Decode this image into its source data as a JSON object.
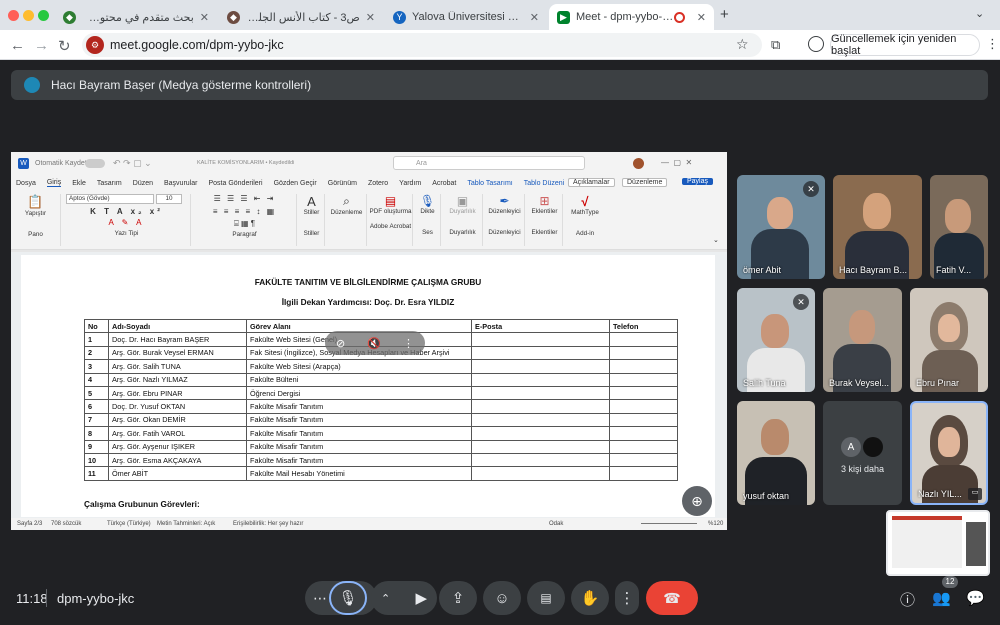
{
  "browser": {
    "tabs": [
      {
        "label": "بحث متقدم في محتوى المكتبة الش",
        "active": false
      },
      {
        "label": "ص3 - كتاب الأنس الجليل بتاريخ ال",
        "active": false
      },
      {
        "label": "Yalova Üniversitesi Uzaktan E",
        "active": false
      },
      {
        "label": "Meet - dpm-yybo-jkc",
        "active": true
      }
    ],
    "new_tab": "+",
    "url": "meet.google.com/dpm-yybo-jkc",
    "update_button": "Güncellemek için yeniden başlat",
    "menu": "⋮"
  },
  "meet": {
    "presenter_banner": "Hacı Bayram Başer (Medya gösterme kontrolleri)",
    "time": "11:18",
    "meeting_code": "dpm-yybo-jkc",
    "participant_count": "12",
    "participants": [
      {
        "name": "ömer Abit",
        "muted": true
      },
      {
        "name": "Hacı Bayram B...",
        "muted": false
      },
      {
        "name": "Fatih V...",
        "muted": false
      },
      {
        "name": "Salih Tuna",
        "muted": true
      },
      {
        "name": "Burak Veysel...",
        "muted": false
      },
      {
        "name": "Ebru Pınar",
        "muted": false
      },
      {
        "name": "yusuf oktan",
        "muted": false
      },
      {
        "name": "3 kişi daha",
        "avatar_letter": "A"
      },
      {
        "name": "Nazlı YIL...",
        "muted": false
      }
    ]
  },
  "word": {
    "autosave": "Otomatik Kaydet",
    "doc_title": "KALİTE KOMİSYONLARIM • Kaydedildi",
    "search": "Ara",
    "menu": [
      "Dosya",
      "Giriş",
      "Ekle",
      "Tasarım",
      "Düzen",
      "Başvurular",
      "Posta Gönderileri",
      "Gözden Geçir",
      "Görünüm",
      "Zotero",
      "Yardım",
      "Acrobat",
      "Tablo Tasarımı",
      "Tablo Düzeni"
    ],
    "comments_btn": "Açıklamalar",
    "editing_btn": "Düzenleme",
    "share_btn": "Paylaş",
    "font": "Aptos (Gövde)",
    "font_size": "10",
    "groups": [
      "Pano",
      "Yazı Tipi",
      "Paragraf",
      "Stiller",
      "Adobe Acrobat",
      "Ses",
      "Duyarlılık",
      "Düzenleyici",
      "Eklentiler",
      "Add-in"
    ],
    "ribbon_btns": [
      "Yapıştır",
      "Stiller",
      "Düzenleme",
      "PDF oluşturma",
      "Dikte",
      "Duyarlılık",
      "Düzenleyici",
      "Eklentiler",
      "MathType"
    ],
    "heading": "FAKÜLTE TANITIM VE BİLGİLENDİRME ÇALIŞMA GRUBU",
    "subheading": "İlgili Dekan Yardımcısı: Doç. Dr. Esra YILDIZ",
    "table_headers": [
      "No",
      "Adı-Soyadı",
      "Görev Alanı",
      "E-Posta",
      "Telefon"
    ],
    "rows": [
      [
        "1",
        "Doç. Dr. Hacı Bayram BAŞER",
        "Fakülte Web Sitesi (Genel)"
      ],
      [
        "2",
        "Arş. Gör. Burak Veysel ERMAN",
        "Fak Sitesi (İngilizce), Sosyal Medya Hesapları ve Haber Arşivi"
      ],
      [
        "3",
        "Arş. Gör. Salih TUNA",
        "Fakülte Web Sitesi (Arapça)"
      ],
      [
        "4",
        "Arş. Gör. Nazlı YILMAZ",
        "Fakülte Bülteni"
      ],
      [
        "5",
        "Arş. Gör. Ebru PINAR",
        "Öğrenci Dergisi"
      ],
      [
        "6",
        "Doç. Dr. Yusuf OKTAN",
        "Fakülte Misafir Tanıtım"
      ],
      [
        "7",
        "Arş. Gör. Okan DEMİR",
        "Fakülte Misafir Tanıtım"
      ],
      [
        "8",
        "Arş. Gör. Fatih VAROL",
        "Fakülte Misafir Tanıtım"
      ],
      [
        "9",
        "Arş. Gör. Ayşenur IŞIKER",
        "Fakülte Misafir Tanıtım"
      ],
      [
        "10",
        "Arş. Gör. Esma AKÇAKAYA",
        "Fakülte Misafir Tanıtım"
      ],
      [
        "11",
        "Ömer ABİT",
        "Fakülte Mail Hesabı Yönetimi"
      ]
    ],
    "section": "Çalışma Grubunun Görevleri:",
    "status": {
      "page": "Sayfa 2/3",
      "words": "708 sözcük",
      "lang": "Türkçe (Türkiye)",
      "predict": "Metin Tahminleri: Açık",
      "access": "Erişilebilirlik: Her şey hazır",
      "focus": "Odak",
      "zoom": "%120"
    }
  }
}
